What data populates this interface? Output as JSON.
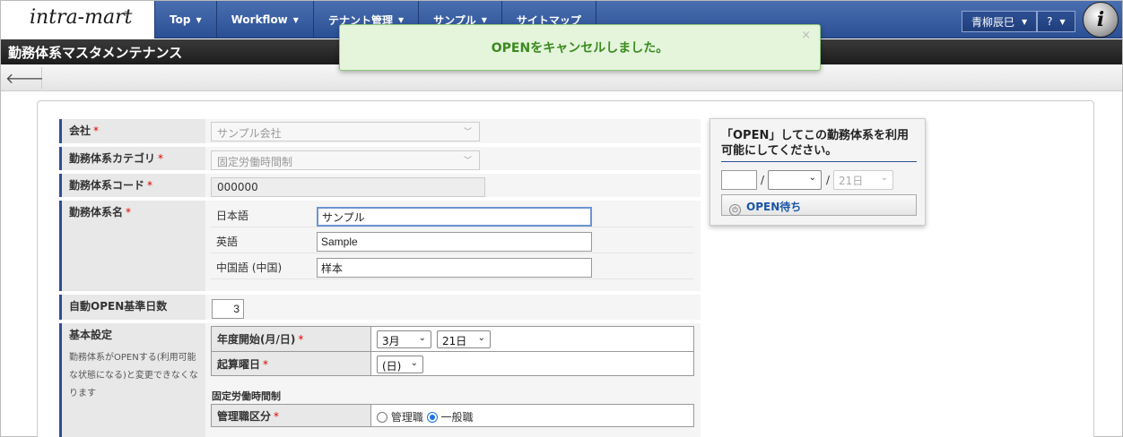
{
  "header": {
    "logo_text": "intra-mart",
    "nav": [
      {
        "label": "Top"
      },
      {
        "label": "Workflow"
      },
      {
        "label": "テナント管理"
      },
      {
        "label": "サンプル"
      },
      {
        "label": "サイトマップ"
      }
    ],
    "user_name": "青柳辰巳",
    "help_label": "?"
  },
  "page_title": "勤務体系マスタメンテナンス",
  "toast": {
    "message": "OPENをキャンセルしました。",
    "close": "×"
  },
  "form": {
    "company": {
      "label": "会社",
      "value": "サンプル会社"
    },
    "category": {
      "label": "勤務体系カテゴリ",
      "value": "固定労働時間制"
    },
    "code": {
      "label": "勤務体系コード",
      "value": "000000"
    },
    "name": {
      "label": "勤務体系名",
      "rows": [
        {
          "lang": "日本語",
          "value": "サンプル"
        },
        {
          "lang": "英語",
          "value": "Sample"
        },
        {
          "lang": "中国語 (中国)",
          "value": "样本"
        }
      ]
    },
    "auto_open": {
      "label": "自動OPEN基準日数",
      "value": "3"
    },
    "basic": {
      "label": "基本設定",
      "note": "勤務体系がOPENする(利用可能な状態になる)と変更できなくなります",
      "fiscal_start": {
        "label": "年度開始(月/日)",
        "month": "3月",
        "day": "21日"
      },
      "calc_weekday": {
        "label": "起算曜日",
        "value": "(日)"
      },
      "section_title": "固定労働時間制",
      "manager_class": {
        "label": "管理職区分",
        "option1": "管理職",
        "option2": "一般職"
      }
    },
    "required_mark": "*"
  },
  "open_card": {
    "title": "「OPEN」してこの勤務体系を利用可能にしてください。",
    "sep1": "/",
    "sep2": "/",
    "day": "21日",
    "button": "OPEN待ち"
  }
}
